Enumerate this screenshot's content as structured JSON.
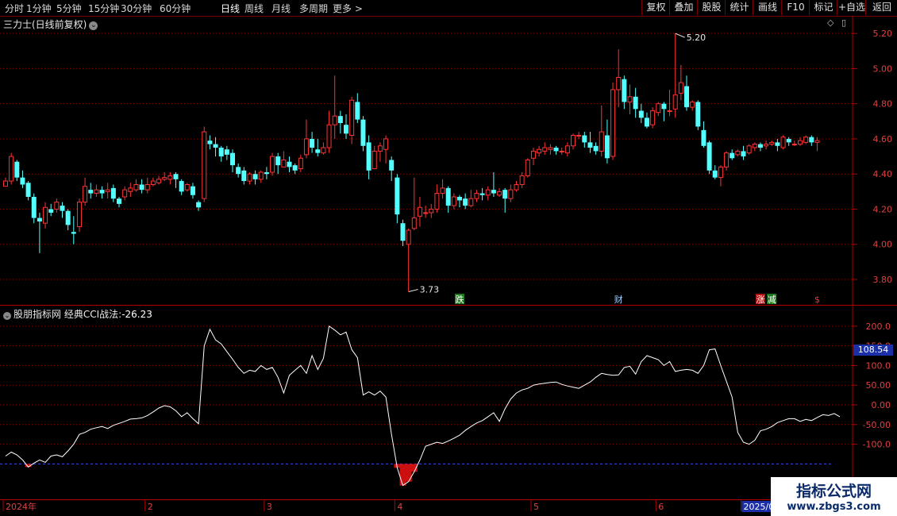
{
  "toolbar": {
    "periods": [
      "分时",
      "1分钟",
      "5分钟",
      "15分钟",
      "30分钟",
      "60分钟",
      "日线",
      "周线",
      "月线",
      "多周期",
      "更多 >"
    ],
    "active_period": "日线",
    "right_buttons": [
      "复权",
      "叠加",
      "股股",
      "统计",
      "画线",
      "F10",
      "标记",
      "+自选",
      "返回"
    ]
  },
  "main_chart": {
    "title": "三力士(日线前复权)",
    "y_ticks": [
      "5.20",
      "5.00",
      "4.80",
      "4.60",
      "4.40",
      "4.20",
      "4.00",
      "3.80"
    ],
    "max_label": "5.20",
    "min_label": "3.73",
    "event_markers": [
      {
        "label": "跌",
        "color": "#ffffff",
        "bg": "#1c7a1c",
        "x_index": 80
      },
      {
        "label": "财",
        "color": "#9ad0ff",
        "bg": "#000000",
        "x_index": 108
      },
      {
        "label": "涨",
        "color": "#ffffff",
        "bg": "#b01010",
        "x_index": 133
      },
      {
        "label": "减",
        "color": "#ffffff",
        "bg": "#1c7a1c",
        "x_index": 135
      },
      {
        "label": "$",
        "color": "#ff3030",
        "bg": "#000000",
        "x_index": 143
      }
    ],
    "colors": {
      "up": "#ff3333",
      "down": "#54ffff",
      "grid": "#8a0000",
      "axis": "#b00000"
    }
  },
  "indicator": {
    "name": "股朋指标网",
    "formula": "经典CCI战法:",
    "value": "-26.23",
    "y_ticks": [
      "200.0",
      "150.0",
      "100.0",
      "50.00",
      "0.00",
      "-50.00",
      "-100.0"
    ],
    "current_value": "108.54",
    "threshold": -150
  },
  "x_axis": {
    "labels": [
      "2024年",
      "2",
      "3",
      "4",
      "5",
      "6",
      "2025/06"
    ]
  },
  "chart_data": {
    "type": "candlestick",
    "title": "三力士(日线前复权)",
    "ylim": [
      3.66,
      5.3
    ],
    "candles": [
      [
        4.33,
        4.36,
        4.34,
        4.38
      ],
      [
        4.36,
        4.5,
        4.34,
        4.52
      ],
      [
        4.47,
        4.38,
        4.36,
        4.48
      ],
      [
        4.38,
        4.34,
        4.32,
        4.42
      ],
      [
        4.35,
        4.27,
        4.25,
        4.36
      ],
      [
        4.27,
        4.15,
        4.12,
        4.29
      ],
      [
        4.15,
        4.13,
        3.95,
        4.18
      ],
      [
        4.12,
        4.21,
        4.09,
        4.24
      ],
      [
        4.2,
        4.18,
        4.16,
        4.23
      ],
      [
        4.2,
        4.24,
        4.18,
        4.26
      ],
      [
        4.22,
        4.19,
        4.15,
        4.24
      ],
      [
        4.19,
        4.11,
        4.08,
        4.2
      ],
      [
        4.07,
        4.06,
        4.0,
        4.16
      ],
      [
        4.1,
        4.24,
        4.07,
        4.26
      ],
      [
        4.24,
        4.33,
        4.22,
        4.38
      ],
      [
        4.31,
        4.29,
        4.26,
        4.35
      ],
      [
        4.29,
        4.31,
        4.27,
        4.34
      ],
      [
        4.31,
        4.29,
        4.26,
        4.33
      ],
      [
        4.3,
        4.31,
        4.26,
        4.35
      ],
      [
        4.32,
        4.26,
        4.24,
        4.34
      ],
      [
        4.26,
        4.23,
        4.21,
        4.27
      ],
      [
        4.27,
        4.31,
        4.25,
        4.33
      ],
      [
        4.3,
        4.32,
        4.27,
        4.35
      ],
      [
        4.31,
        4.34,
        4.3,
        4.37
      ],
      [
        4.34,
        4.31,
        4.29,
        4.37
      ],
      [
        4.31,
        4.34,
        4.29,
        4.38
      ],
      [
        4.34,
        4.36,
        4.33,
        4.38
      ],
      [
        4.35,
        4.37,
        4.34,
        4.39
      ],
      [
        4.37,
        4.38,
        4.36,
        4.41
      ],
      [
        4.37,
        4.39,
        4.34,
        4.41
      ],
      [
        4.4,
        4.37,
        4.32,
        4.41
      ],
      [
        4.36,
        4.3,
        4.28,
        4.37
      ],
      [
        4.31,
        4.34,
        4.3,
        4.35
      ],
      [
        4.33,
        4.28,
        4.26,
        4.35
      ],
      [
        4.24,
        4.21,
        4.19,
        4.25
      ],
      [
        4.26,
        4.64,
        4.24,
        4.67
      ],
      [
        4.59,
        4.57,
        4.54,
        4.62
      ],
      [
        4.57,
        4.55,
        4.5,
        4.61
      ],
      [
        4.55,
        4.5,
        4.47,
        4.56
      ],
      [
        4.54,
        4.51,
        4.48,
        4.56
      ],
      [
        4.52,
        4.45,
        4.41,
        4.54
      ],
      [
        4.44,
        4.4,
        4.38,
        4.46
      ],
      [
        4.42,
        4.36,
        4.34,
        4.44
      ],
      [
        4.36,
        4.4,
        4.34,
        4.41
      ],
      [
        4.4,
        4.37,
        4.34,
        4.42
      ],
      [
        4.37,
        4.41,
        4.35,
        4.42
      ],
      [
        4.41,
        4.4,
        4.37,
        4.44
      ],
      [
        4.41,
        4.5,
        4.39,
        4.52
      ],
      [
        4.5,
        4.45,
        4.4,
        4.52
      ],
      [
        4.44,
        4.48,
        4.44,
        4.53
      ],
      [
        4.47,
        4.44,
        4.41,
        4.5
      ],
      [
        4.45,
        4.42,
        4.4,
        4.46
      ],
      [
        4.43,
        4.49,
        4.41,
        4.51
      ],
      [
        4.51,
        4.6,
        4.49,
        4.71
      ],
      [
        4.6,
        4.55,
        4.52,
        4.64
      ],
      [
        4.54,
        4.52,
        4.5,
        4.6
      ],
      [
        4.52,
        4.55,
        4.51,
        4.58
      ],
      [
        4.55,
        4.68,
        4.52,
        4.76
      ],
      [
        4.68,
        4.73,
        4.6,
        4.96
      ],
      [
        4.73,
        4.69,
        4.63,
        4.76
      ],
      [
        4.68,
        4.63,
        4.6,
        4.74
      ],
      [
        4.62,
        4.82,
        4.57,
        4.84
      ],
      [
        4.81,
        4.71,
        4.69,
        4.86
      ],
      [
        4.71,
        4.56,
        4.53,
        4.73
      ],
      [
        4.58,
        4.42,
        4.37,
        4.62
      ],
      [
        4.43,
        4.53,
        4.43,
        4.56
      ],
      [
        4.53,
        4.56,
        4.47,
        4.58
      ],
      [
        4.54,
        4.6,
        4.46,
        4.62
      ],
      [
        4.48,
        4.42,
        4.36,
        4.5
      ],
      [
        4.38,
        4.17,
        4.12,
        4.4
      ],
      [
        4.12,
        4.02,
        3.99,
        4.14
      ],
      [
        4.0,
        4.08,
        3.73,
        4.09
      ],
      [
        4.09,
        4.15,
        4.08,
        4.38
      ],
      [
        4.16,
        4.21,
        4.1,
        4.27
      ],
      [
        4.18,
        4.18,
        4.15,
        4.22
      ],
      [
        4.18,
        4.2,
        4.15,
        4.23
      ],
      [
        4.2,
        4.29,
        4.18,
        4.34
      ],
      [
        4.29,
        4.32,
        4.26,
        4.37
      ],
      [
        4.32,
        4.22,
        4.18,
        4.33
      ],
      [
        4.22,
        4.27,
        4.2,
        4.29
      ],
      [
        4.27,
        4.25,
        4.21,
        4.28
      ],
      [
        4.26,
        4.22,
        4.2,
        4.29
      ],
      [
        4.22,
        4.26,
        4.21,
        4.31
      ],
      [
        4.26,
        4.29,
        4.24,
        4.31
      ],
      [
        4.29,
        4.28,
        4.25,
        4.32
      ],
      [
        4.28,
        4.31,
        4.25,
        4.33
      ],
      [
        4.31,
        4.29,
        4.27,
        4.41
      ],
      [
        4.28,
        4.3,
        4.27,
        4.32
      ],
      [
        4.31,
        4.26,
        4.18,
        4.32
      ],
      [
        4.26,
        4.31,
        4.24,
        4.34
      ],
      [
        4.31,
        4.34,
        4.3,
        4.36
      ],
      [
        4.34,
        4.39,
        4.32,
        4.41
      ],
      [
        4.39,
        4.48,
        4.38,
        4.49
      ],
      [
        4.49,
        4.53,
        4.45,
        4.55
      ],
      [
        4.52,
        4.54,
        4.5,
        4.56
      ],
      [
        4.53,
        4.55,
        4.51,
        4.58
      ],
      [
        4.54,
        4.55,
        4.51,
        4.57
      ],
      [
        4.55,
        4.53,
        4.51,
        4.56
      ],
      [
        4.53,
        4.53,
        4.51,
        4.55
      ],
      [
        4.52,
        4.56,
        4.5,
        4.58
      ],
      [
        4.56,
        4.62,
        4.54,
        4.63
      ],
      [
        4.62,
        4.62,
        4.6,
        4.64
      ],
      [
        4.62,
        4.58,
        4.55,
        4.64
      ],
      [
        4.58,
        4.55,
        4.52,
        4.64
      ],
      [
        4.56,
        4.53,
        4.51,
        4.58
      ],
      [
        4.53,
        4.64,
        4.5,
        4.79
      ],
      [
        4.62,
        4.49,
        4.46,
        4.71
      ],
      [
        4.5,
        4.88,
        4.48,
        4.92
      ],
      [
        4.88,
        4.95,
        4.78,
        5.11
      ],
      [
        4.94,
        4.81,
        4.77,
        4.96
      ],
      [
        4.81,
        4.84,
        4.74,
        4.91
      ],
      [
        4.84,
        4.77,
        4.72,
        4.89
      ],
      [
        4.76,
        4.72,
        4.69,
        4.8
      ],
      [
        4.72,
        4.67,
        4.66,
        4.75
      ],
      [
        4.68,
        4.76,
        4.66,
        4.78
      ],
      [
        4.75,
        4.8,
        4.73,
        4.81
      ],
      [
        4.8,
        4.77,
        4.7,
        4.81
      ],
      [
        4.76,
        4.76,
        4.73,
        4.88
      ],
      [
        4.77,
        4.85,
        4.72,
        5.2
      ],
      [
        4.86,
        4.92,
        4.82,
        5.02
      ],
      [
        4.9,
        4.78,
        4.76,
        4.96
      ],
      [
        4.78,
        4.81,
        4.76,
        4.82
      ],
      [
        4.81,
        4.67,
        4.65,
        4.82
      ],
      [
        4.65,
        4.56,
        4.55,
        4.7
      ],
      [
        4.58,
        4.42,
        4.4,
        4.59
      ],
      [
        4.42,
        4.38,
        4.37,
        4.45
      ],
      [
        4.38,
        4.44,
        4.33,
        4.45
      ],
      [
        4.44,
        4.52,
        4.42,
        4.53
      ],
      [
        4.52,
        4.49,
        4.48,
        4.54
      ],
      [
        4.51,
        4.53,
        4.5,
        4.54
      ],
      [
        4.53,
        4.5,
        4.48,
        4.56
      ],
      [
        4.52,
        4.56,
        4.51,
        4.57
      ],
      [
        4.55,
        4.57,
        4.53,
        4.58
      ],
      [
        4.57,
        4.55,
        4.53,
        4.58
      ],
      [
        4.56,
        4.57,
        4.54,
        4.59
      ],
      [
        4.57,
        4.58,
        4.56,
        4.59
      ],
      [
        4.58,
        4.56,
        4.53,
        4.6
      ],
      [
        4.55,
        4.61,
        4.54,
        4.62
      ],
      [
        4.6,
        4.58,
        4.56,
        4.61
      ],
      [
        4.57,
        4.57,
        4.56,
        4.59
      ],
      [
        4.57,
        4.59,
        4.56,
        4.61
      ],
      [
        4.58,
        4.61,
        4.57,
        4.62
      ],
      [
        4.61,
        4.58,
        4.56,
        4.62
      ],
      [
        4.58,
        4.59,
        4.53,
        4.61
      ]
    ],
    "cci": [
      -130,
      -120,
      -127,
      -140,
      -158,
      -148,
      -140,
      -146,
      -130,
      -127,
      -132,
      -117,
      -100,
      -75,
      -70,
      -62,
      -58,
      -55,
      -60,
      -52,
      -47,
      -42,
      -36,
      -35,
      -33,
      -27,
      -18,
      -8,
      -2,
      -5,
      -15,
      -30,
      -20,
      -35,
      -48,
      150,
      192,
      165,
      155,
      135,
      116,
      95,
      80,
      88,
      85,
      100,
      90,
      95,
      70,
      30,
      75,
      88,
      100,
      80,
      125,
      90,
      118,
      200,
      190,
      178,
      185,
      140,
      120,
      25,
      33,
      25,
      35,
      20,
      -75,
      -160,
      -205,
      -195,
      -170,
      -140,
      -105,
      -100,
      -95,
      -98,
      -92,
      -85,
      -77,
      -65,
      -55,
      -46,
      -40,
      -30,
      -20,
      -42,
      -10,
      15,
      30,
      38,
      42,
      50,
      53,
      55,
      57,
      58,
      52,
      48,
      45,
      42,
      50,
      58,
      70,
      80,
      77,
      75,
      76,
      95,
      98,
      78,
      110,
      125,
      120,
      115,
      100,
      110,
      85,
      88,
      90,
      88,
      80,
      100,
      140,
      142,
      100,
      60,
      20,
      -70,
      -95,
      -100,
      -90,
      -66,
      -62,
      -55,
      -45,
      -40,
      -35,
      -35,
      -42,
      -37,
      -40,
      -32,
      -25,
      -27,
      -22,
      -30
    ]
  }
}
